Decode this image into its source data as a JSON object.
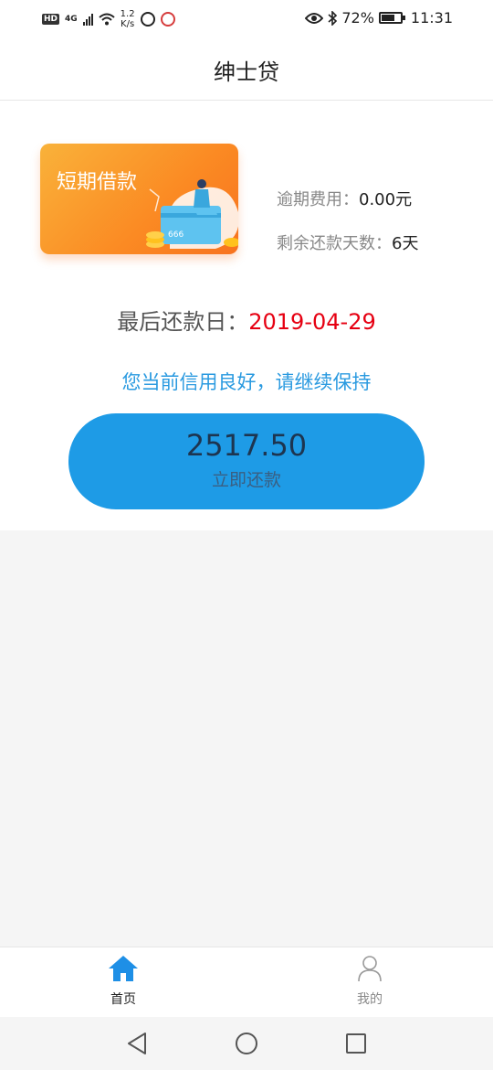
{
  "status_bar": {
    "hd": "HD",
    "network": "4G",
    "speed_value": "1.2",
    "speed_unit": "K/s",
    "battery": "72%",
    "battery_level": 0.72,
    "time": "11:31"
  },
  "header": {
    "title": "绅士贷"
  },
  "loan_card": {
    "title": "短期借款"
  },
  "info": {
    "overdue_label": "逾期费用：",
    "overdue_value": "0.00元",
    "days_label": "剩余还款天数：",
    "days_value": "6天"
  },
  "due": {
    "label": "最后还款日：",
    "date": "2019-04-29"
  },
  "credit_message": "您当前信用良好，请继续保持",
  "pay_button": {
    "amount": "2517.50",
    "label": "立即还款"
  },
  "tabs": [
    {
      "label": "首页",
      "icon": "home-icon",
      "active": true
    },
    {
      "label": "我的",
      "icon": "user-icon",
      "active": false
    }
  ],
  "colors": {
    "accent": "#1e9be6",
    "card": "#fb8a23",
    "due_date": "#e60012",
    "credit": "#2a9ae0"
  }
}
